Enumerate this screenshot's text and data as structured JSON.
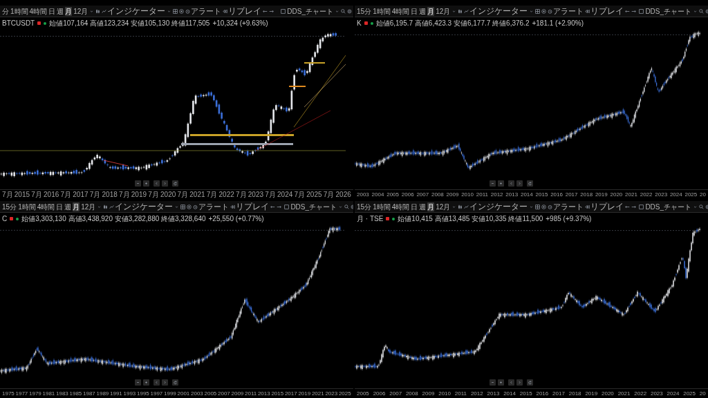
{
  "panels": [
    {
      "toolbar": {
        "intervals": [
          {
            "label": "分",
            "selected": false
          },
          {
            "label": "1時間",
            "selected": false
          },
          {
            "label": "4時間",
            "selected": false
          },
          {
            "label": "日",
            "selected": false
          },
          {
            "label": "週",
            "selected": false
          },
          {
            "label": "月",
            "selected": true
          },
          {
            "label": "12月",
            "selected": false
          }
        ],
        "indicator_label": "インジケーター",
        "alert_label": "アラート",
        "replay_label": "リプレイ",
        "layout_name": "DDS_チャート"
      },
      "legend": {
        "symbol": "BTCUSDT",
        "ohlc": "始値107,164 高値123,234 安値105,130 終値117,505",
        "change": "+10,324 (+9.63%)"
      },
      "x_axis": [
        "7月",
        "2015",
        "7月",
        "2016",
        "7月",
        "2017",
        "7月",
        "2018",
        "7月",
        "2019",
        "7月",
        "2020",
        "7月",
        "2021",
        "7月",
        "2022",
        "7月",
        "2023",
        "7月",
        "2024",
        "7月",
        "2025",
        "7月",
        "2026"
      ]
    },
    {
      "toolbar": {
        "intervals": [
          {
            "label": "15分",
            "selected": false
          },
          {
            "label": "1時間",
            "selected": false
          },
          {
            "label": "4時間",
            "selected": false
          },
          {
            "label": "日",
            "selected": false
          },
          {
            "label": "週",
            "selected": false
          },
          {
            "label": "月",
            "selected": true
          },
          {
            "label": "12月",
            "selected": false
          }
        ],
        "indicator_label": "インジケーター",
        "alert_label": "アラート",
        "replay_label": "リプレイ",
        "layout_name": "DDS_チャート"
      },
      "legend": {
        "symbol": "K",
        "ohlc": "始値6,195.7 高値6,423.3 安値6,177.7 終値6,376.2",
        "change": "+181.1 (+2.90%)"
      },
      "x_axis": [
        "2003",
        "2004",
        "2005",
        "2006",
        "2007",
        "2008",
        "2009",
        "2010",
        "2011",
        "2012",
        "2013",
        "2014",
        "2015",
        "2016",
        "2017",
        "2018",
        "2019",
        "2020",
        "2021",
        "2022",
        "2023",
        "2024",
        "2025",
        "20"
      ]
    },
    {
      "toolbar": {
        "intervals": [
          {
            "label": "15分",
            "selected": false
          },
          {
            "label": "1時間",
            "selected": false
          },
          {
            "label": "4時間",
            "selected": false
          },
          {
            "label": "日",
            "selected": false
          },
          {
            "label": "週",
            "selected": false
          },
          {
            "label": "月",
            "selected": true
          },
          {
            "label": "12月",
            "selected": false
          }
        ],
        "indicator_label": "インジケーター",
        "alert_label": "アラート",
        "replay_label": "リプレイ",
        "layout_name": "DDS_チャート"
      },
      "legend": {
        "symbol": "C",
        "ohlc": "始値3,303,130 高値3,438,920 安値3,282,880 終値3,328,640",
        "change": "+25,550 (+0.77%)"
      },
      "x_axis": [
        "1975",
        "1977",
        "1979",
        "1981",
        "1983",
        "1985",
        "1987",
        "1989",
        "1991",
        "1993",
        "1995",
        "1997",
        "1999",
        "2001",
        "2003",
        "2005",
        "2007",
        "2009",
        "2011",
        "2013",
        "2015",
        "2017",
        "2019",
        "2021",
        "2023",
        "2025"
      ]
    },
    {
      "toolbar": {
        "intervals": [
          {
            "label": "15分",
            "selected": false
          },
          {
            "label": "1時間",
            "selected": false
          },
          {
            "label": "4時間",
            "selected": false
          },
          {
            "label": "日",
            "selected": false
          },
          {
            "label": "週",
            "selected": false
          },
          {
            "label": "月",
            "selected": true
          },
          {
            "label": "12月",
            "selected": false
          }
        ],
        "indicator_label": "インジケーター",
        "alert_label": "アラート",
        "replay_label": "リプレイ",
        "layout_name": "DDS_チャート"
      },
      "legend": {
        "symbol": "月 · TSE",
        "ohlc": "始値10,415 高値13,485 安値10,335 終値11,500",
        "change": "+985 (+9.37%)"
      },
      "x_axis": [
        "2005",
        "2006",
        "2007",
        "2008",
        "2009",
        "2010",
        "2011",
        "2012",
        "2013",
        "2014",
        "2015",
        "2016",
        "2017",
        "2018",
        "2019",
        "2020",
        "2021",
        "2022",
        "2023",
        "2024",
        "2025",
        "20"
      ]
    }
  ]
}
